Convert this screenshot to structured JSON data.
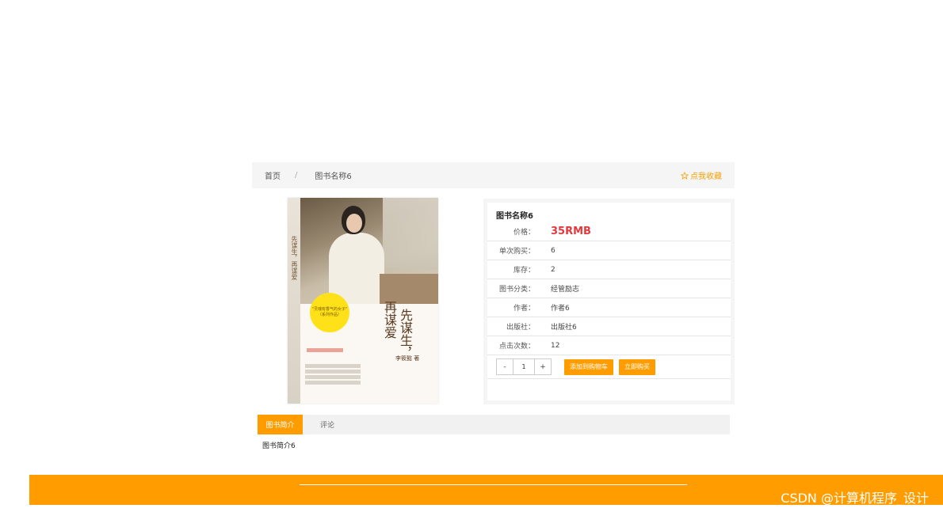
{
  "breadcrumb": {
    "home": "首页",
    "separator": "/",
    "current": "图书名称6",
    "favorite_label": "点我收藏"
  },
  "cover": {
    "spine_title": "先谋生，再谋爱",
    "title_line1": "先谋生，",
    "title_line2": "再谋爱",
    "author": "李筱懿 著",
    "badge_line1": "\"灵魂有香气的女子\"",
    "badge_line2": "（系列作品）"
  },
  "book": {
    "title": "图书名称6",
    "rows": [
      {
        "label": "价格：",
        "value": "35RMB"
      },
      {
        "label": "单次购买：",
        "value": "6"
      },
      {
        "label": "库存：",
        "value": "2"
      },
      {
        "label": "图书分类：",
        "value": "经管励志"
      },
      {
        "label": "作者：",
        "value": "作者6"
      },
      {
        "label": "出版社：",
        "value": "出版社6"
      },
      {
        "label": "点击次数：",
        "value": "12"
      }
    ]
  },
  "purchase": {
    "minus": "-",
    "quantity": "1",
    "plus": "+",
    "add_to_cart": "添加到购物车",
    "buy_now": "立即购买"
  },
  "tabs": [
    {
      "label": "图书简介",
      "active": true
    },
    {
      "label": "评论",
      "active": false
    }
  ],
  "tab_content": "图书简介6",
  "watermark": "CSDN @计算机程序_设计",
  "colors": {
    "accent": "#ff9d00",
    "price": "#e4393c",
    "favorite": "#f5a10a"
  }
}
